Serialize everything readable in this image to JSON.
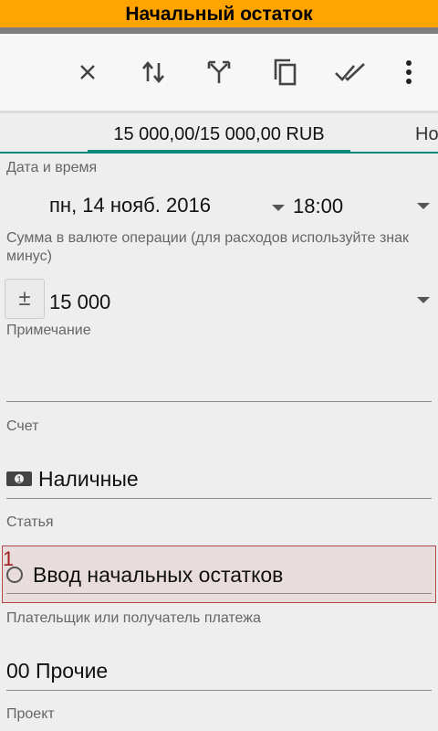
{
  "title": "Начальный остаток",
  "toolbar": {
    "icons": [
      "close-icon",
      "swap-vertical-icon",
      "split-icon",
      "copy-icon",
      "done-all-icon",
      "more-vert-icon"
    ]
  },
  "tabs": {
    "active": "15 000,00/15 000,00 RUB",
    "next": "Но"
  },
  "date_time": {
    "label": "Дата и время",
    "date": "пн, 14 нояб. 2016",
    "time": "18:00"
  },
  "amount": {
    "label": "Сумма в валюте операции (для расходов используйте знак минус)",
    "sign": "±",
    "value": "15 000"
  },
  "note": {
    "label": "Примечание",
    "value": ""
  },
  "account": {
    "label": "Счет",
    "value": "Наличные"
  },
  "article": {
    "label": "Статья",
    "value": "Ввод начальных остатков",
    "marker": "1"
  },
  "payer": {
    "label": "Плательщик или получатель платежа",
    "value": "00 Прочие"
  },
  "project": {
    "label": "Проект"
  },
  "colors": {
    "title_bg": "#ffa400",
    "accent": "#00897b",
    "highlight_border": "#b04a4a"
  }
}
